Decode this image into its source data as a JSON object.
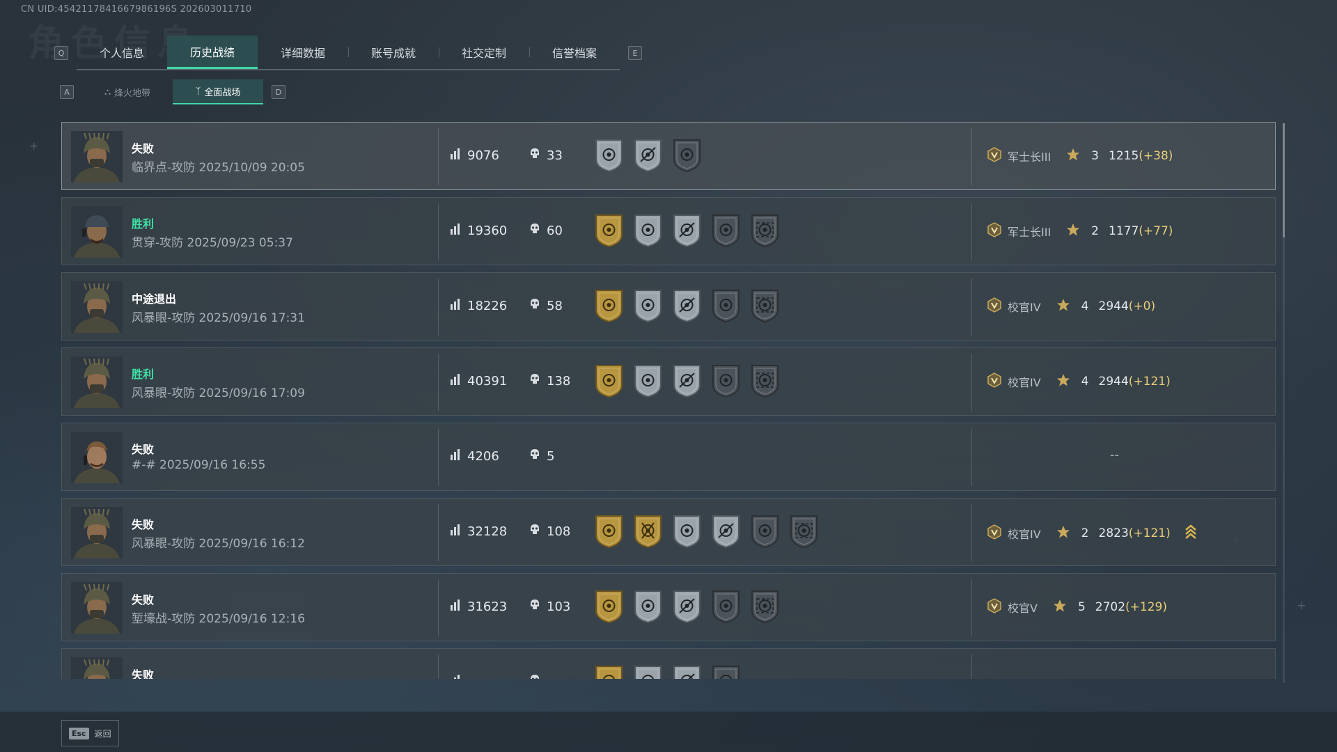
{
  "header": {
    "uid": "CN UID:4542117841667986196S 202603011710",
    "bg_title": "角色信息"
  },
  "main_tabs": {
    "left_key": "Q",
    "right_key": "E",
    "items": [
      {
        "label": "个人信息",
        "active": false
      },
      {
        "label": "历史战绩",
        "active": true
      },
      {
        "label": "详细数据",
        "active": false
      },
      {
        "label": "账号成就",
        "active": false
      },
      {
        "label": "社交定制",
        "active": false
      },
      {
        "label": "信誉档案",
        "active": false
      }
    ]
  },
  "sub_tabs": {
    "left_key": "A",
    "right_key": "D",
    "items": [
      {
        "label": "烽火地带",
        "icon": "extraction-icon",
        "active": false
      },
      {
        "label": "全面战场",
        "icon": "battlefield-icon",
        "active": true
      }
    ]
  },
  "matches": [
    {
      "result": "失败",
      "win": false,
      "map": "临界点-攻防",
      "time": "2025/10/09 20:05",
      "score": "9076",
      "kills": "33",
      "medals": [
        "silver-kill",
        "silver-sniper",
        "dark-vehicle"
      ],
      "rank_icon": "rank-III-icon",
      "rank": "军士长III",
      "stars": "3",
      "elo": "1215",
      "delta": "(+38)",
      "avatar": "helmet",
      "selected": true
    },
    {
      "result": "胜利",
      "win": true,
      "map": "贯穿-攻防",
      "time": "2025/09/23 05:37",
      "score": "19360",
      "kills": "60",
      "medals": [
        "gold-mvp",
        "silver-kill",
        "silver-sniper",
        "dark-vehicle",
        "dark-scout"
      ],
      "rank_icon": "rank-III-icon",
      "rank": "军士长III",
      "stars": "2",
      "elo": "1177",
      "delta": "(+77)",
      "avatar": "cap"
    },
    {
      "result": "中途退出",
      "win": false,
      "map": "风暴眼-攻防",
      "time": "2025/09/16 17:31",
      "score": "18226",
      "kills": "58",
      "medals": [
        "gold-mvp",
        "silver-kill",
        "silver-sniper",
        "dark-vehicle",
        "dark-scout"
      ],
      "rank_icon": "rank-IV-icon",
      "rank": "校官IV",
      "stars": "4",
      "elo": "2944",
      "delta": "(+0)",
      "avatar": "helmet"
    },
    {
      "result": "胜利",
      "win": true,
      "map": "风暴眼-攻防",
      "time": "2025/09/16 17:09",
      "score": "40391",
      "kills": "138",
      "medals": [
        "gold-mvp",
        "silver-kill",
        "silver-sniper",
        "dark-vehicle",
        "dark-scout"
      ],
      "rank_icon": "rank-IV-icon",
      "rank": "校官IV",
      "stars": "4",
      "elo": "2944",
      "delta": "(+121)",
      "avatar": "helmet"
    },
    {
      "result": "失败",
      "win": false,
      "map": "#-#",
      "time": "2025/09/16 16:55",
      "score": "4206",
      "kills": "5",
      "medals": [],
      "rank": null,
      "no_rank": "--",
      "avatar": "headset"
    },
    {
      "result": "失败",
      "win": false,
      "map": "风暴眼-攻防",
      "time": "2025/09/16 16:12",
      "score": "32128",
      "kills": "108",
      "medals": [
        "gold-mvp",
        "gold-engineer",
        "silver-kill",
        "silver-sniper",
        "dark-vehicle",
        "dark-scout"
      ],
      "rank_icon": "rank-IV-icon",
      "rank": "校官IV",
      "stars": "2",
      "elo": "2823",
      "delta": "(+121)",
      "streak": true,
      "avatar": "helmet"
    },
    {
      "result": "失败",
      "win": false,
      "map": "堑壕战-攻防",
      "time": "2025/09/16 12:16",
      "score": "31623",
      "kills": "103",
      "medals": [
        "gold-mvp",
        "silver-kill",
        "silver-sniper",
        "dark-vehicle",
        "dark-scout"
      ],
      "rank_icon": "rank-V-icon",
      "rank": "校官V",
      "stars": "5",
      "elo": "2702",
      "delta": "(+129)",
      "avatar": "helmet"
    },
    {
      "result": "失败",
      "win": false,
      "map": "",
      "time": "",
      "score": "",
      "kills": "",
      "medals": [
        "gold-mvp",
        "silver-kill",
        "silver-sniper",
        "dark-vehicle"
      ],
      "rank": null,
      "no_rank": "",
      "avatar": "helmet"
    }
  ],
  "footer": {
    "esc_key": "Esc",
    "back_label": "返回"
  },
  "colors": {
    "accent": "#3fd7a8",
    "win": "#3fe1a6",
    "delta": "#e8cf78",
    "gold_medal": "#b8963f"
  }
}
